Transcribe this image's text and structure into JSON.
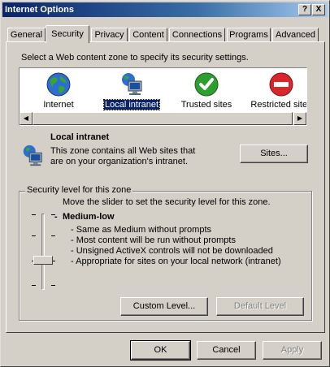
{
  "window": {
    "title": "Internet Options",
    "help_label": "?",
    "close_label": "X"
  },
  "tabs": [
    {
      "label": "General"
    },
    {
      "label": "Security",
      "active": true
    },
    {
      "label": "Privacy"
    },
    {
      "label": "Content"
    },
    {
      "label": "Connections"
    },
    {
      "label": "Programs"
    },
    {
      "label": "Advanced"
    }
  ],
  "security": {
    "instruction": "Select a Web content zone to specify its security settings.",
    "zones": [
      {
        "label": "Internet",
        "icon": "globe-icon"
      },
      {
        "label": "Local intranet",
        "icon": "intranet-icon",
        "selected": true
      },
      {
        "label": "Trusted sites",
        "icon": "checkmark-icon"
      },
      {
        "label": "Restricted sites",
        "icon": "restricted-icon"
      }
    ],
    "zone_info": {
      "title": "Local intranet",
      "desc_line1": "This zone contains all Web sites that",
      "desc_line2": "are on your organization's intranet.",
      "sites_button": "Sites..."
    },
    "level": {
      "group_label": "Security level for this zone",
      "slider_hint": "Move the slider to set the security level for this zone.",
      "level_name": "Medium-low",
      "bullets": [
        "- Same as Medium without prompts",
        "- Most content will be run without prompts",
        "- Unsigned ActiveX controls will not be downloaded",
        "- Appropriate for sites on your local network (intranet)"
      ],
      "slider_level": 2,
      "slider_levels_total": 5,
      "custom_button": "Custom Level...",
      "default_button": "Default Level"
    }
  },
  "footer": {
    "ok": "OK",
    "cancel": "Cancel",
    "apply": "Apply"
  }
}
